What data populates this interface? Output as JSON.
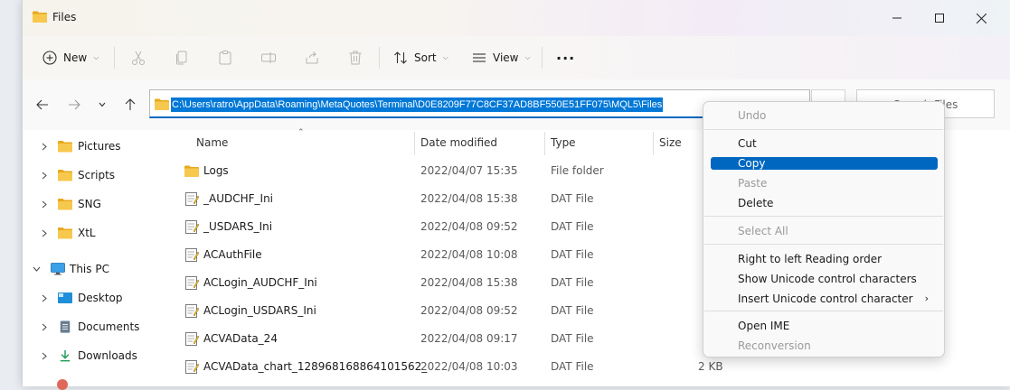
{
  "window": {
    "title": "Files"
  },
  "toolbar": {
    "new_label": "New",
    "sort_label": "Sort",
    "view_label": "View",
    "more_label": "···"
  },
  "address": {
    "path": "C:\\Users\\ratro\\AppData\\Roaming\\MetaQuotes\\Terminal\\D0E8209F77C8CF37AD8BF550E51FF075\\MQL5\\Files"
  },
  "search": {
    "placeholder": "Search Files"
  },
  "nav": {
    "items": [
      {
        "label": "Pictures",
        "icon": "folder-icon"
      },
      {
        "label": "Scripts",
        "icon": "folder-icon"
      },
      {
        "label": "SNG",
        "icon": "folder-icon"
      },
      {
        "label": "XtL",
        "icon": "folder-icon"
      },
      {
        "label": "This PC",
        "icon": "computer-icon"
      },
      {
        "label": "Desktop",
        "icon": "desktop-icon"
      },
      {
        "label": "Documents",
        "icon": "documents-icon"
      },
      {
        "label": "Downloads",
        "icon": "download-icon"
      }
    ]
  },
  "columns": {
    "name": "Name",
    "date": "Date modified",
    "type": "Type",
    "size": "Size"
  },
  "files": [
    {
      "name": "Logs",
      "date": "2022/04/07 15:35",
      "type": "File folder",
      "size": "",
      "icon": "folder-icon"
    },
    {
      "name": "_AUDCHF_Ini",
      "date": "2022/04/08 15:38",
      "type": "DAT File",
      "size": "",
      "icon": "dat-file-icon"
    },
    {
      "name": "_USDARS_Ini",
      "date": "2022/04/08 09:52",
      "type": "DAT File",
      "size": "",
      "icon": "dat-file-icon"
    },
    {
      "name": "ACAuthFile",
      "date": "2022/04/08 10:08",
      "type": "DAT File",
      "size": "",
      "icon": "dat-file-icon"
    },
    {
      "name": "ACLogin_AUDCHF_Ini",
      "date": "2022/04/08 15:38",
      "type": "DAT File",
      "size": "",
      "icon": "dat-file-icon"
    },
    {
      "name": "ACLogin_USDARS_Ini",
      "date": "2022/04/08 09:52",
      "type": "DAT File",
      "size": "",
      "icon": "dat-file-icon"
    },
    {
      "name": "ACVAData_24",
      "date": "2022/04/08 09:17",
      "type": "DAT File",
      "size": "",
      "icon": "dat-file-icon"
    },
    {
      "name": "ACVAData_chart_128968168864101562_",
      "date": "2022/04/08 10:03",
      "type": "DAT File",
      "size": "2 KB",
      "icon": "dat-file-icon"
    }
  ],
  "context_menu": {
    "undo": "Undo",
    "cut": "Cut",
    "copy": "Copy",
    "paste": "Paste",
    "delete": "Delete",
    "select_all": "Select All",
    "rtl": "Right to left Reading order",
    "show_unicode": "Show Unicode control characters",
    "insert_unicode": "Insert Unicode control character",
    "open_ime": "Open IME",
    "reconversion": "Reconversion"
  },
  "colors": {
    "accent": "#0067c0",
    "selection": "#0078d7",
    "folder": "#f2c14e"
  }
}
